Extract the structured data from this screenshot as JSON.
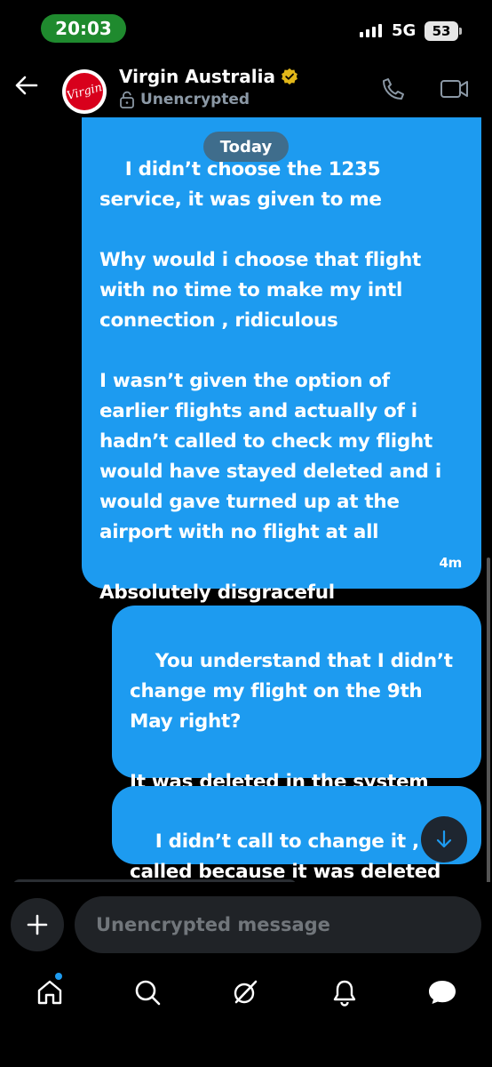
{
  "status_bar": {
    "time": "20:03",
    "network": "5G",
    "battery": "53"
  },
  "header": {
    "contact_name": "Virgin Australia",
    "encryption_status": "Unencrypted",
    "avatar_logo": "Virgin"
  },
  "chat": {
    "date_divider": "Today",
    "messages": [
      {
        "text": "I didn’t choose the 1235 service, it was given to me\n\nWhy would i choose that flight with no time to make my intl connection , ridiculous\n\nI wasn’t given the option of earlier flights and actually of i hadn’t called to check my flight would have stayed deleted and i would gave turned up at the airport with no flight at all\n\nAbsolutely disgraceful",
        "time": "4m"
      },
      {
        "text": "You understand that I didn’t change my flight on the 9th May right?\n\nIt was deleted in the system"
      },
      {
        "text": "I didn’t call to change it , i called because it was deleted"
      }
    ]
  },
  "composer": {
    "placeholder": "Unencrypted message"
  },
  "icons": {
    "back": "back-arrow-icon",
    "verified": "verified-badge-icon",
    "lock": "unlock-icon",
    "call": "phone-icon",
    "video": "video-camera-icon",
    "scroll_down": "arrow-down-icon",
    "add": "plus-icon",
    "nav": [
      "home-icon",
      "search-icon",
      "grok-icon",
      "bell-icon",
      "messages-icon"
    ]
  },
  "colors": {
    "bubble": "#1d9bf0",
    "background": "#000000",
    "time_pill": "#1f8a2e",
    "verified": "#e2b719"
  }
}
